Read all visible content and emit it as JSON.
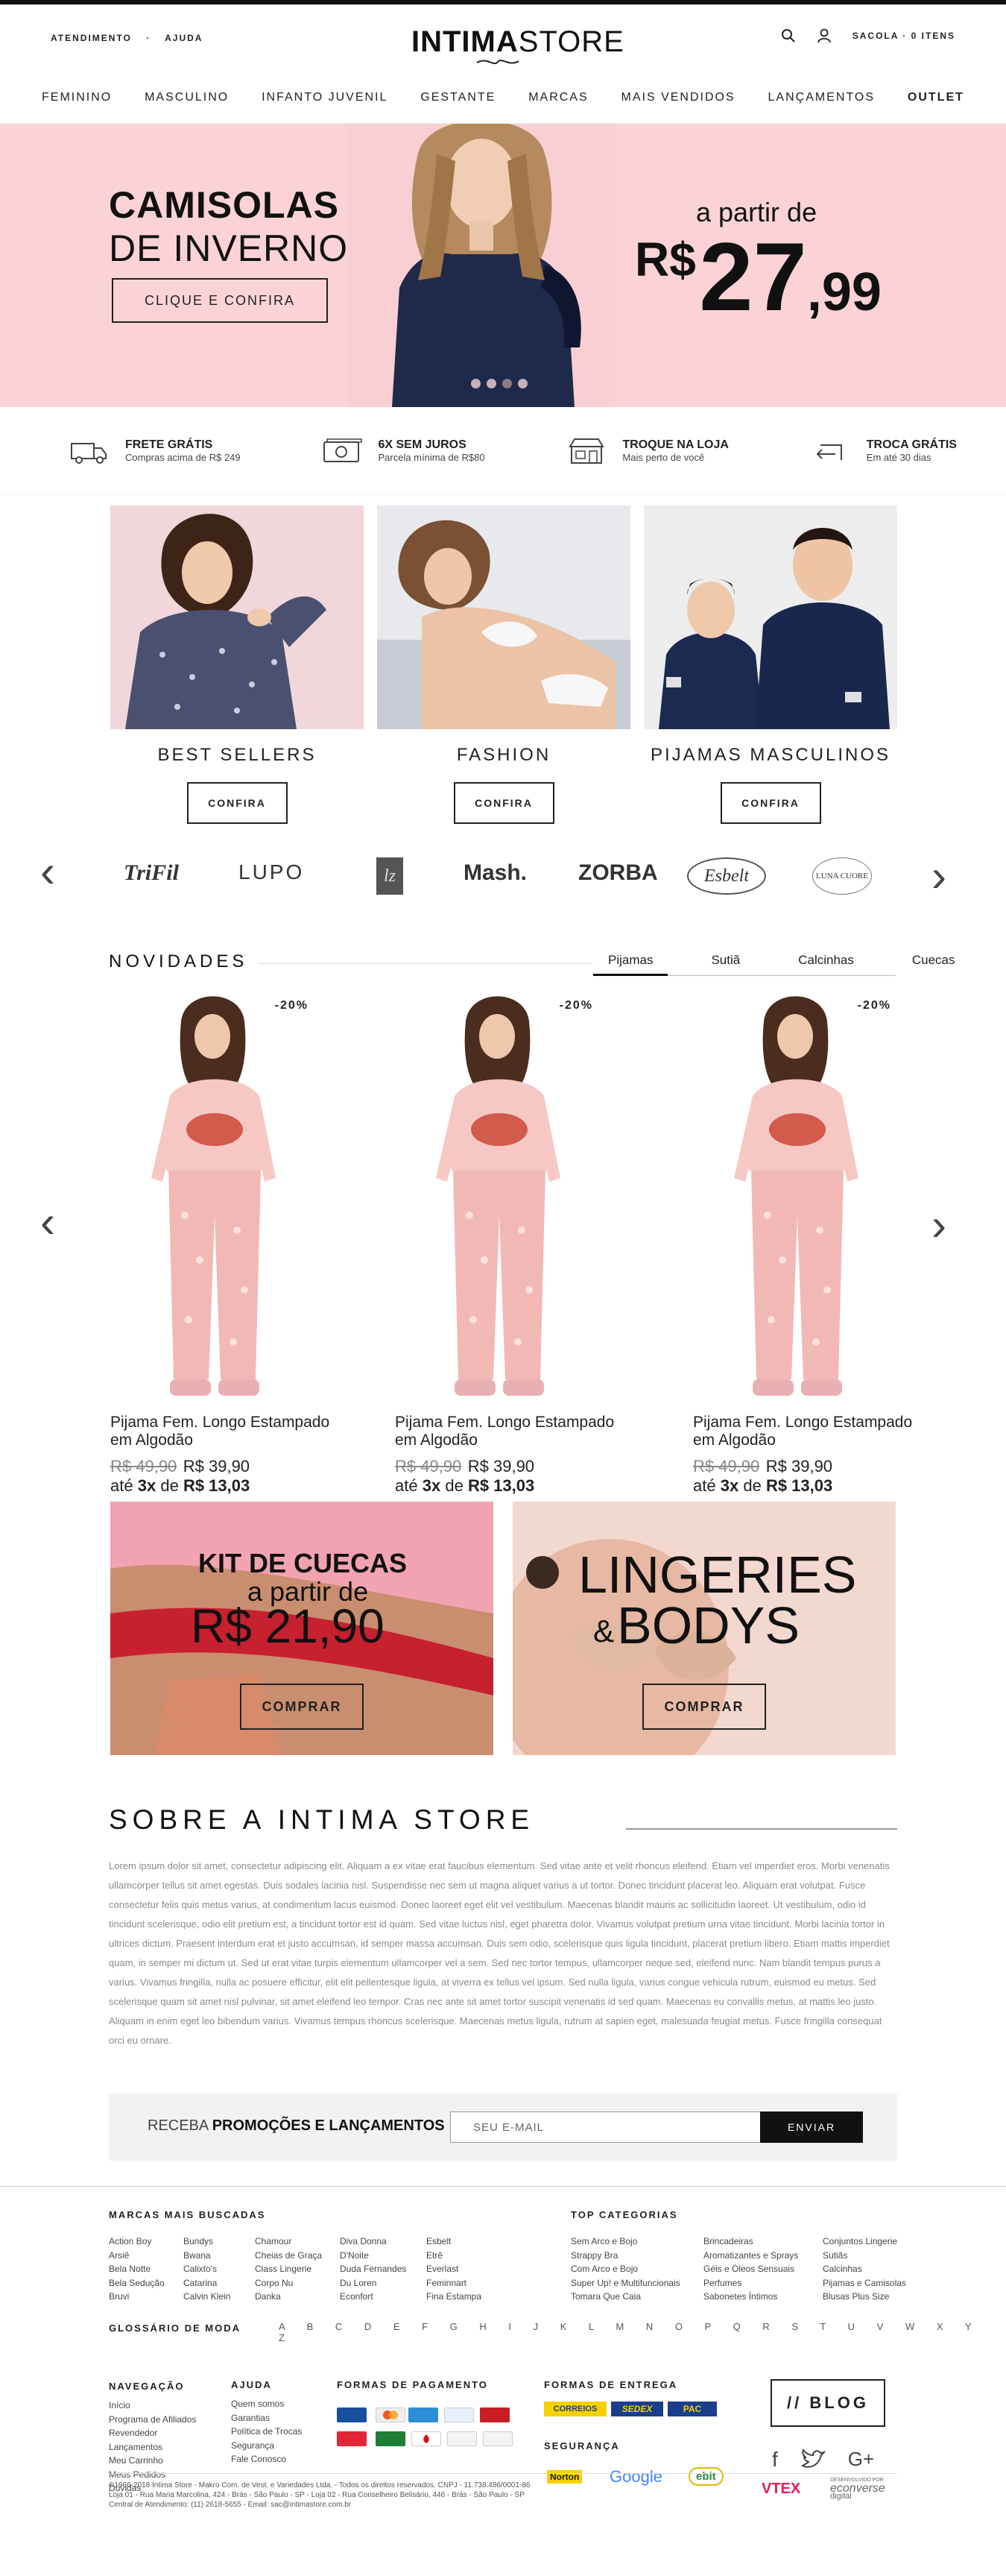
{
  "header": {
    "link1": "ATENDIMENTO",
    "link2": "AJUDA",
    "logo_bold": "INTIMA",
    "logo_thin": "STORE",
    "bag": "SACOLA",
    "items": "0 ITENS"
  },
  "nav": [
    "FEMININO",
    "MASCULINO",
    "INFANTO JUVENIL",
    "GESTANTE",
    "MARCAS",
    "MAIS VENDIDOS",
    "LANÇAMENTOS",
    "OUTLET"
  ],
  "hero": {
    "line1": "CAMISOLAS",
    "line2": "DE INVERNO",
    "button": "CLIQUE E CONFIRA",
    "from": "a partir de",
    "currency": "R$",
    "price": "27",
    "cents": ",99",
    "slides": 4,
    "active_slide": 2
  },
  "benefits": [
    {
      "icon": "truck-icon",
      "title": "FRETE GRÁTIS",
      "sub": "Compras acima de R$ 249"
    },
    {
      "icon": "money-icon",
      "title": "6X SEM JUROS",
      "sub": "Parcela mínima de R$80"
    },
    {
      "icon": "store-icon",
      "title": "TROQUE NA LOJA",
      "sub": "Mais perto de você"
    },
    {
      "icon": "return-icon",
      "title": "TROCA GRÁTIS",
      "sub": "Em até 30 dias"
    }
  ],
  "categories": [
    {
      "label": "BEST SELLERS",
      "button": "CONFIRA"
    },
    {
      "label": "FASHION",
      "button": "CONFIRA"
    },
    {
      "label": "PIJAMAS MASCULINOS",
      "button": "CONFIRA"
    }
  ],
  "brands": [
    "TriFil",
    "LUPO",
    "lz",
    "Mash.",
    "ZORBA",
    "Esbelt",
    "LUNA CUORE"
  ],
  "novidades": {
    "title": "NOVIDADES",
    "tabs": [
      "Pijamas",
      "Sutiã",
      "Calcinhas",
      "Cuecas"
    ],
    "products": [
      {
        "badge": "-20%",
        "name": "Pijama Fem. Longo Estampado em Algodão",
        "old": "R$ 49,90",
        "new": "R$ 39,90",
        "inst_pre": "até",
        "inst_n": "3x",
        "inst_mid": "de",
        "inst_val": "R$ 13,03"
      },
      {
        "badge": "-20%",
        "name": "Pijama Fem. Longo Estampado em Algodão",
        "old": "R$ 49,90",
        "new": "R$ 39,90",
        "inst_pre": "até",
        "inst_n": "3x",
        "inst_mid": "de",
        "inst_val": "R$ 13,03"
      },
      {
        "badge": "-20%",
        "name": "Pijama Fem. Longo Estampado em Algodão",
        "old": "R$ 49,90",
        "new": "R$ 39,90",
        "inst_pre": "até",
        "inst_n": "3x",
        "inst_mid": "de",
        "inst_val": "R$ 13,03"
      }
    ]
  },
  "promo": {
    "kit": "KIT DE CUECAS",
    "from": "a partir de",
    "price": "R$ 21,90",
    "btn1": "COMPRAR",
    "ling1": "LINGERIES",
    "amp": "&",
    "ling2": "BODYS",
    "btn2": "COMPRAR"
  },
  "about": {
    "title": "SOBRE A INTIMA STORE",
    "text": "Lorem ipsum dolor sit amet, consectetur adipiscing elit. Aliquam a ex vitae erat faucibus elementum. Sed vitae ante et velit rhoncus eleifend. Etiam vel imperdiet eros. Morbi venenatis ullamcorper tellus sit amet egestas. Duis sodales lacinia nisl. Suspendisse nec sem ut magna aliquet varius a ut tortor. Donec tincidunt placerat leo. Aliquam erat volutpat. Fusce consectetur felis quis metus varius, at condimentum lacus euismod. Donec laoreet eget elit vel vestibulum. Maecenas blandit mauris ac sollicitudin laoreet. Ut vestibulum, odio id tincidunt scelerisque, odio elit pretium est, a tincidunt tortor est id quam. Sed vitae luctus nisl, eget pharetra dolor. Vivamus volutpat pretium urna vitae tincidunt. Morbi lacinia tortor in ultrices dictum. Praesent interdum erat et justo accumsan, id semper massa accumsan. Duis sem odio, scelerisque quis ligula tincidunt, placerat pretium libero. Etiam mattis imperdiet quam, in semper mi dictum ut. Sed ut erat vitae turpis elementum ullamcorper vel a sem. Sed nec tortor tempus, ullamcorper neque sed, eleifend nunc. Nam blandit tempus purus a varius. Vivamus fringilla, nulla ac posuere efficitur, elit elit pellentesque ligula, at viverra ex tellus vel ipsum. Sed nulla ligula, varius congue vehicula rutrum, euismod eu metus. Sed scelerisque quam sit amet nisl pulvinar, sit amet eleifend leo tempor. Cras nec ante sit amet tortor suscipit venenatis id sed quam. Maecenas eu convallis metus, at mattis leo justo. Aliquam in enim eget leo bibendum varius. Vivamus tempus rhoncus scelerisque. Maecenas metus ligula, rutrum at sapien eget, malesuada feugiat metus. Fusce fringilla consequat orci eu ornare."
  },
  "newsletter": {
    "pre": "RECEBA",
    "bold": "PROMOÇÕES E LANÇAMENTOS",
    "placeholder": "SEU E-MAIL",
    "button": "ENVIAR"
  },
  "footer": {
    "marcas_title": "MARCAS MAIS BUSCADAS",
    "marcas": [
      [
        "Action Boy",
        "Arsiê",
        "Bela Notte",
        "Bela Sedução",
        "Bruvi"
      ],
      [
        "Bundys",
        "Bwana",
        "Calixto's",
        "Catarina",
        "Calvin Klein"
      ],
      [
        "Chamour",
        "Cheias de Graça",
        "Class Lingerie",
        "Corpo Nu",
        "Danka"
      ],
      [
        "Diva Donna",
        "D'Noite",
        "Duda Fernandes",
        "Du Loren",
        "Econfort"
      ],
      [
        "Esbelt",
        "Etrê",
        "Everlast",
        "Feminnart",
        "Fina Estampa"
      ]
    ],
    "top_title": "TOP CATEGORIAS",
    "top": [
      [
        "Sem Arco e Bojo",
        "Strappy Bra",
        "Com Arco e Bojo",
        "Super Up! e Multifuncionais",
        "Tomara Que Caia"
      ],
      [
        "Brincadeiras",
        "Aromatizantes e Sprays",
        "Géis e Óleos Sensuais",
        "Perfumes",
        "Sabonetes Íntimos"
      ],
      [
        "Conjuntos Lingerie",
        "Sutiãs",
        "Calcinhas",
        "Pijamas e Camisolas",
        "Blusas Plus Size"
      ]
    ],
    "gloss_title": "GLOSSÁRIO DE MODA",
    "letters": "A B C D E F G H I J K L M N O P Q R S T U V W X Y Z",
    "nav_title": "NAVEGAÇÃO",
    "nav": [
      "Início",
      "Programa de Afiliados",
      "Revendedor",
      "Lançamentos",
      "Meu Carrinho",
      "Meus Pedidos",
      "Dúvidas"
    ],
    "help_title": "AJUDA",
    "help": [
      "Quem somos",
      "Garantias",
      "Política de Trocas",
      "Segurança",
      "Fale Conosco"
    ],
    "pay_title": "FORMAS DE PAGAMENTO",
    "ship_title": "FORMAS DE ENTREGA",
    "ship": [
      "CORREIOS",
      "SEDEX",
      "PAC"
    ],
    "sec_title": "SEGURANÇA",
    "sec": [
      "Norton",
      "Google",
      "ebit"
    ],
    "blog": "// BLOG",
    "copy": [
      "©1966-2018 Intima Store - Makro Com. de Vest. e Variedades Ltda. - Todos os direitos reservados. CNPJ - 11.738.486/0001-86",
      "Loja 01 - Rua Maria Marcolina, 424 - Brás - São Paulo - SP  -  Loja 02 - Rua Conselheiro Belisário, 446 - Brás - São Paulo - SP",
      "Central de Atendimento: (11) 2618-5655 - Email: sac@intimastore.com.br"
    ],
    "vtex": "VTEX",
    "econ_top": "DESENVOLVIDO POR",
    "econ": "econverse",
    "econ_sub": "digital"
  }
}
